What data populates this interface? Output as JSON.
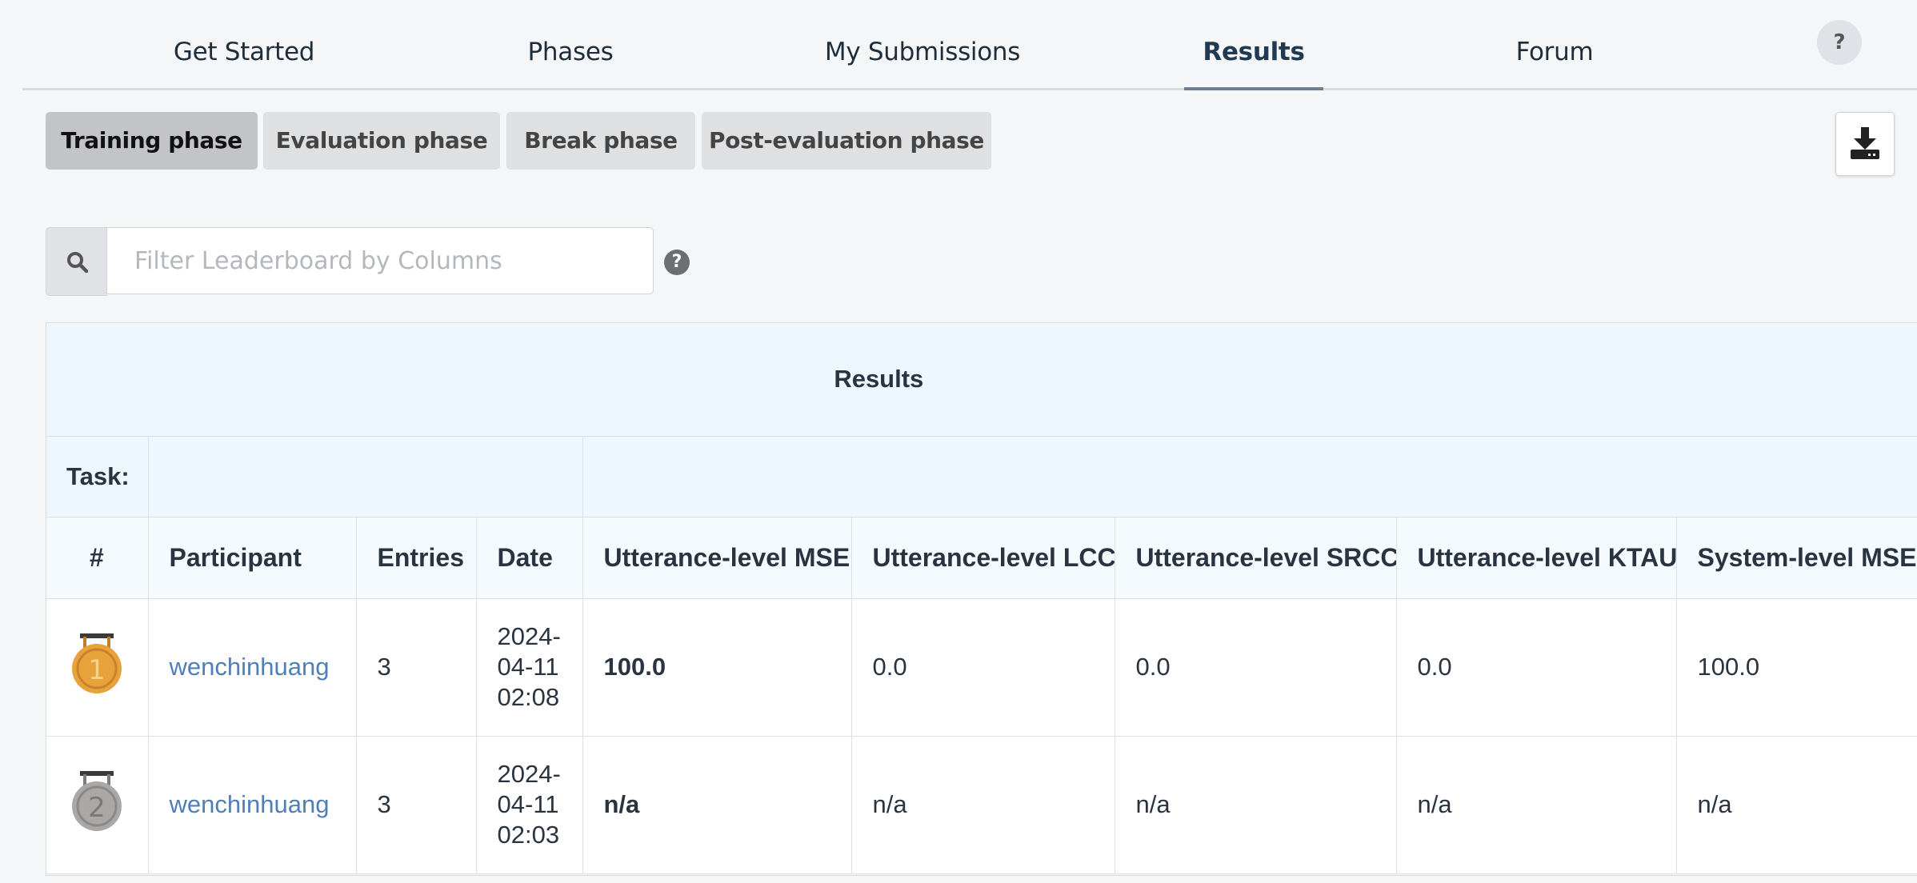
{
  "nav": {
    "tabs": [
      {
        "label": "Get Started"
      },
      {
        "label": "Phases"
      },
      {
        "label": "My Submissions"
      },
      {
        "label": "Results"
      },
      {
        "label": "Forum"
      }
    ],
    "active_tab": "Results",
    "help_label": "?"
  },
  "phases": {
    "buttons": [
      {
        "label": "Training phase"
      },
      {
        "label": "Evaluation phase"
      },
      {
        "label": "Break phase"
      },
      {
        "label": "Post-evaluation phase"
      }
    ],
    "active": "Training phase"
  },
  "filter": {
    "placeholder": "Filter Leaderboard by Columns",
    "help_label": "?"
  },
  "leaderboard": {
    "title": "Results",
    "task_label": "Task:",
    "columns": [
      "#",
      "Participant",
      "Entries",
      "Date",
      "Utterance-level MSE",
      "Utterance-level LCC",
      "Utterance-level SRCC",
      "Utterance-level KTAU",
      "System-level MSE"
    ],
    "rows": [
      {
        "rank": "1",
        "participant": "wenchinhuang",
        "entries": "3",
        "date": "2024-04-11 02:08",
        "utt_mse": "100.0",
        "utt_lcc": "0.0",
        "utt_srcc": "0.0",
        "utt_ktau": "0.0",
        "sys_mse": "100.0"
      },
      {
        "rank": "2",
        "participant": "wenchinhuang",
        "entries": "3",
        "date": "2024-04-11 02:03",
        "utt_mse": "n/a",
        "utt_lcc": "n/a",
        "utt_srcc": "n/a",
        "utt_ktau": "n/a",
        "sys_mse": "n/a"
      }
    ]
  },
  "icons": {
    "search": "search-icon",
    "download": "download-icon",
    "medal_gold": "gold-medal-icon",
    "medal_silver": "silver-medal-icon"
  },
  "colors": {
    "link": "#4f7fb8",
    "gold": "#e8a23c",
    "silver": "#a9a8a6",
    "header_bg": "#eef6fe"
  }
}
